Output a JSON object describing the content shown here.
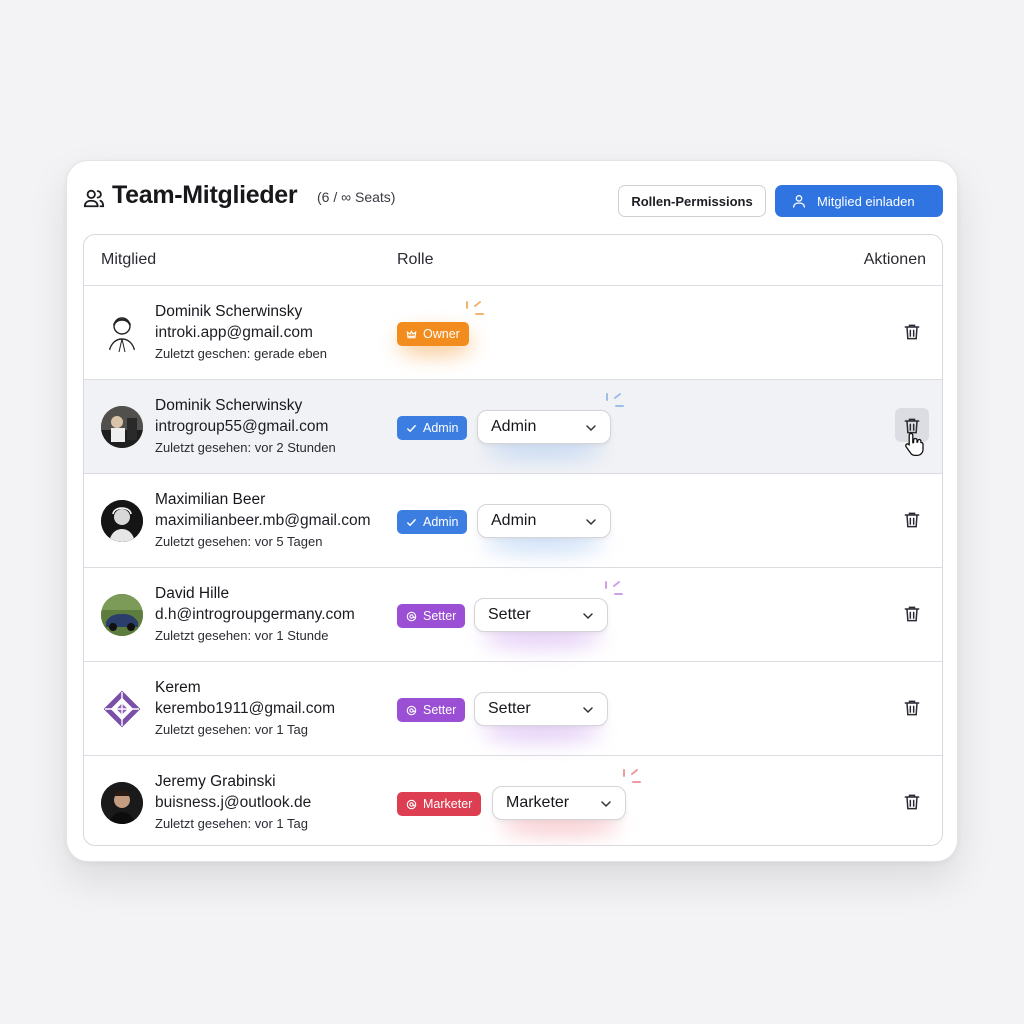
{
  "header": {
    "title": "Team-Mitglieder",
    "seats": "(6 / ∞ Seats)",
    "permissions_button": "Rollen-Permissions",
    "invite_button": "Mitglied einladen",
    "icons": {
      "team": "users-icon",
      "invite": "user-icon"
    }
  },
  "table": {
    "columns": {
      "member": "Mitglied",
      "role": "Rolle",
      "actions": "Aktionen"
    },
    "rows": [
      {
        "name": "Dominik Scherwinsky",
        "email": "introki.app@gmail.com",
        "seen": "Zuletzt geschen: gerade eben",
        "badge": "Owner",
        "badge_icon": "crown-icon",
        "badge_color": "#f28c1f",
        "role_select": null,
        "hovered": false
      },
      {
        "name": "Dominik Scherwinsky",
        "email": "introgroup55@gmail.com",
        "seen": "Zuletzt gesehen: vor 2 Stunden",
        "badge": "Admin",
        "badge_icon": "check-icon",
        "badge_color": "#3b7de0",
        "role_select": "Admin",
        "hovered": true
      },
      {
        "name": "Maximilian Beer",
        "email": "maximilianbeer.mb@gmail.com",
        "seen": "Zuletzt gesehen: vor 5 Tagen",
        "badge": "Admin",
        "badge_icon": "check-icon",
        "badge_color": "#3b7de0",
        "role_select": "Admin",
        "hovered": false
      },
      {
        "name": "David Hille",
        "email": "d.h@introgroupgermany.com",
        "seen": "Zuletzt gesehen: vor 1 Stunde",
        "badge": "Setter",
        "badge_icon": "at-icon",
        "badge_color": "#9a4fd4",
        "role_select": "Setter",
        "hovered": false
      },
      {
        "name": "Kerem",
        "email": "kerembo1911@gmail.com",
        "seen": "Zuletzt gesehen: vor 1 Tag",
        "badge": "Setter",
        "badge_icon": "at-icon",
        "badge_color": "#9a4fd4",
        "role_select": "Setter",
        "hovered": false
      },
      {
        "name": "Jeremy Grabinski",
        "email": "buisness.j@outlook.de",
        "seen": "Zuletzt gesehen: vor 1 Tag",
        "badge": "Marketer",
        "badge_icon": "at-icon",
        "badge_color": "#de3e52",
        "role_select": "Marketer",
        "hovered": false
      }
    ],
    "action_icon": "trash-icon"
  },
  "colors": {
    "accent": "#2f74e0",
    "owner": "#f28c1f",
    "admin": "#3b7de0",
    "setter": "#9a4fd4",
    "marketer": "#de3e52"
  }
}
